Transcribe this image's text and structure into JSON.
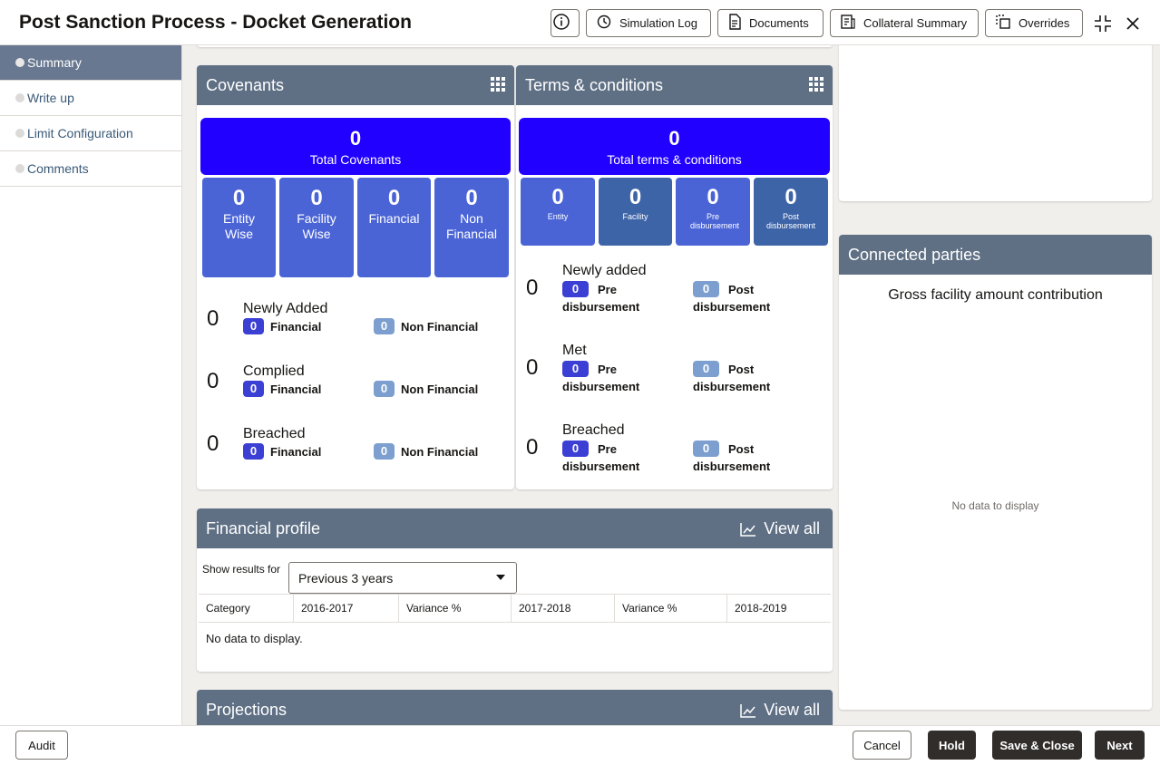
{
  "header": {
    "title": "Post Sanction Process - Docket Generation",
    "buttons": {
      "simulation_log": "Simulation Log",
      "documents": "Documents",
      "collateral_summary": "Collateral Summary",
      "overrides": "Overrides"
    }
  },
  "sidebar": {
    "items": [
      {
        "label": "Summary",
        "active": true
      },
      {
        "label": "Write up"
      },
      {
        "label": "Limit Configuration"
      },
      {
        "label": "Comments"
      }
    ]
  },
  "covenants": {
    "title": "Covenants",
    "total": {
      "value": "0",
      "label": "Total Covenants"
    },
    "boxes": [
      {
        "value": "0",
        "label": "Entity Wise"
      },
      {
        "value": "0",
        "label": "Facility Wise"
      },
      {
        "value": "0",
        "label": "Financial"
      },
      {
        "value": "0",
        "label": "Non Financial"
      }
    ],
    "rows": [
      {
        "count": "0",
        "title": "Newly Added",
        "a_val": "0",
        "a_label": "Financial",
        "b_val": "0",
        "b_label": "Non Financial"
      },
      {
        "count": "0",
        "title": "Complied",
        "a_val": "0",
        "a_label": "Financial",
        "b_val": "0",
        "b_label": "Non Financial"
      },
      {
        "count": "0",
        "title": "Breached",
        "a_val": "0",
        "a_label": "Financial",
        "b_val": "0",
        "b_label": "Non Financial"
      }
    ]
  },
  "terms": {
    "title": "Terms & conditions",
    "total": {
      "value": "0",
      "label": "Total terms & conditions"
    },
    "boxes": [
      {
        "value": "0",
        "label": "Entity"
      },
      {
        "value": "0",
        "label": "Facility"
      },
      {
        "value": "0",
        "label": "Pre disbursement"
      },
      {
        "value": "0",
        "label": "Post disbursement"
      }
    ],
    "rows": [
      {
        "count": "0",
        "title": "Newly added",
        "a_val": "0",
        "a_label1": "Pre",
        "a_label2": "disbursement",
        "b_val": "0",
        "b_label1": "Post",
        "b_label2": "disbursement"
      },
      {
        "count": "0",
        "title": "Met",
        "a_val": "0",
        "a_label1": "Pre",
        "a_label2": "disbursement",
        "b_val": "0",
        "b_label1": "Post",
        "b_label2": "disbursement"
      },
      {
        "count": "0",
        "title": "Breached",
        "a_val": "0",
        "a_label1": "Pre",
        "a_label2": "disbursement",
        "b_val": "0",
        "b_label1": "Post",
        "b_label2": "disbursement"
      }
    ]
  },
  "financial_profile": {
    "title": "Financial profile",
    "view_all": "View all",
    "show_results_label": "Show results for",
    "period": "Previous 3 years",
    "columns": [
      "Category",
      "2016-2017",
      "Variance %",
      "2017-2018",
      "Variance %",
      "2018-2019"
    ],
    "empty": "No data to display."
  },
  "projections": {
    "title": "Projections",
    "view_all": "View all"
  },
  "connected_parties": {
    "title": "Connected parties",
    "subtitle": "Gross facility amount contribution",
    "empty": "No data to display"
  },
  "footer": {
    "audit": "Audit",
    "cancel": "Cancel",
    "hold": "Hold",
    "save_close": "Save & Close",
    "next": "Next"
  }
}
